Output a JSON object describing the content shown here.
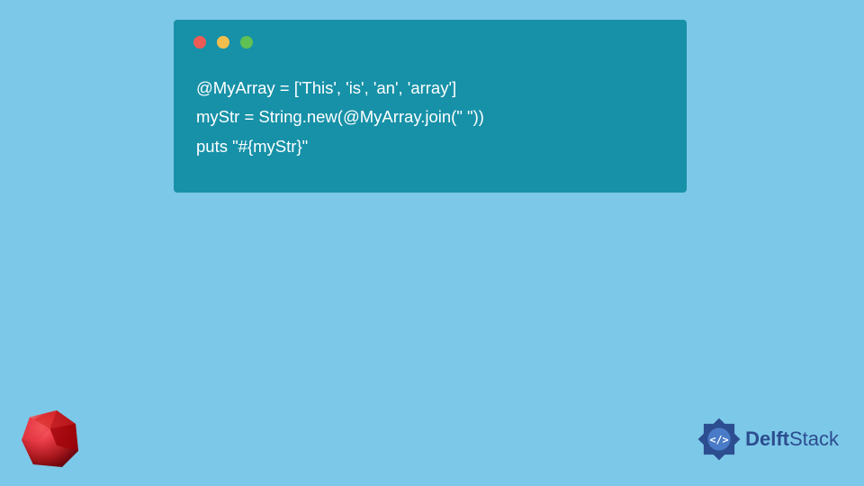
{
  "code": {
    "line1": "@MyArray = ['This', 'is', 'an', 'array']",
    "line2": "myStr = String.new(@MyArray.join(\" \"))",
    "line3": "puts \"#{myStr}\""
  },
  "brand": {
    "name_bold": "Delft",
    "name_light": "Stack"
  }
}
